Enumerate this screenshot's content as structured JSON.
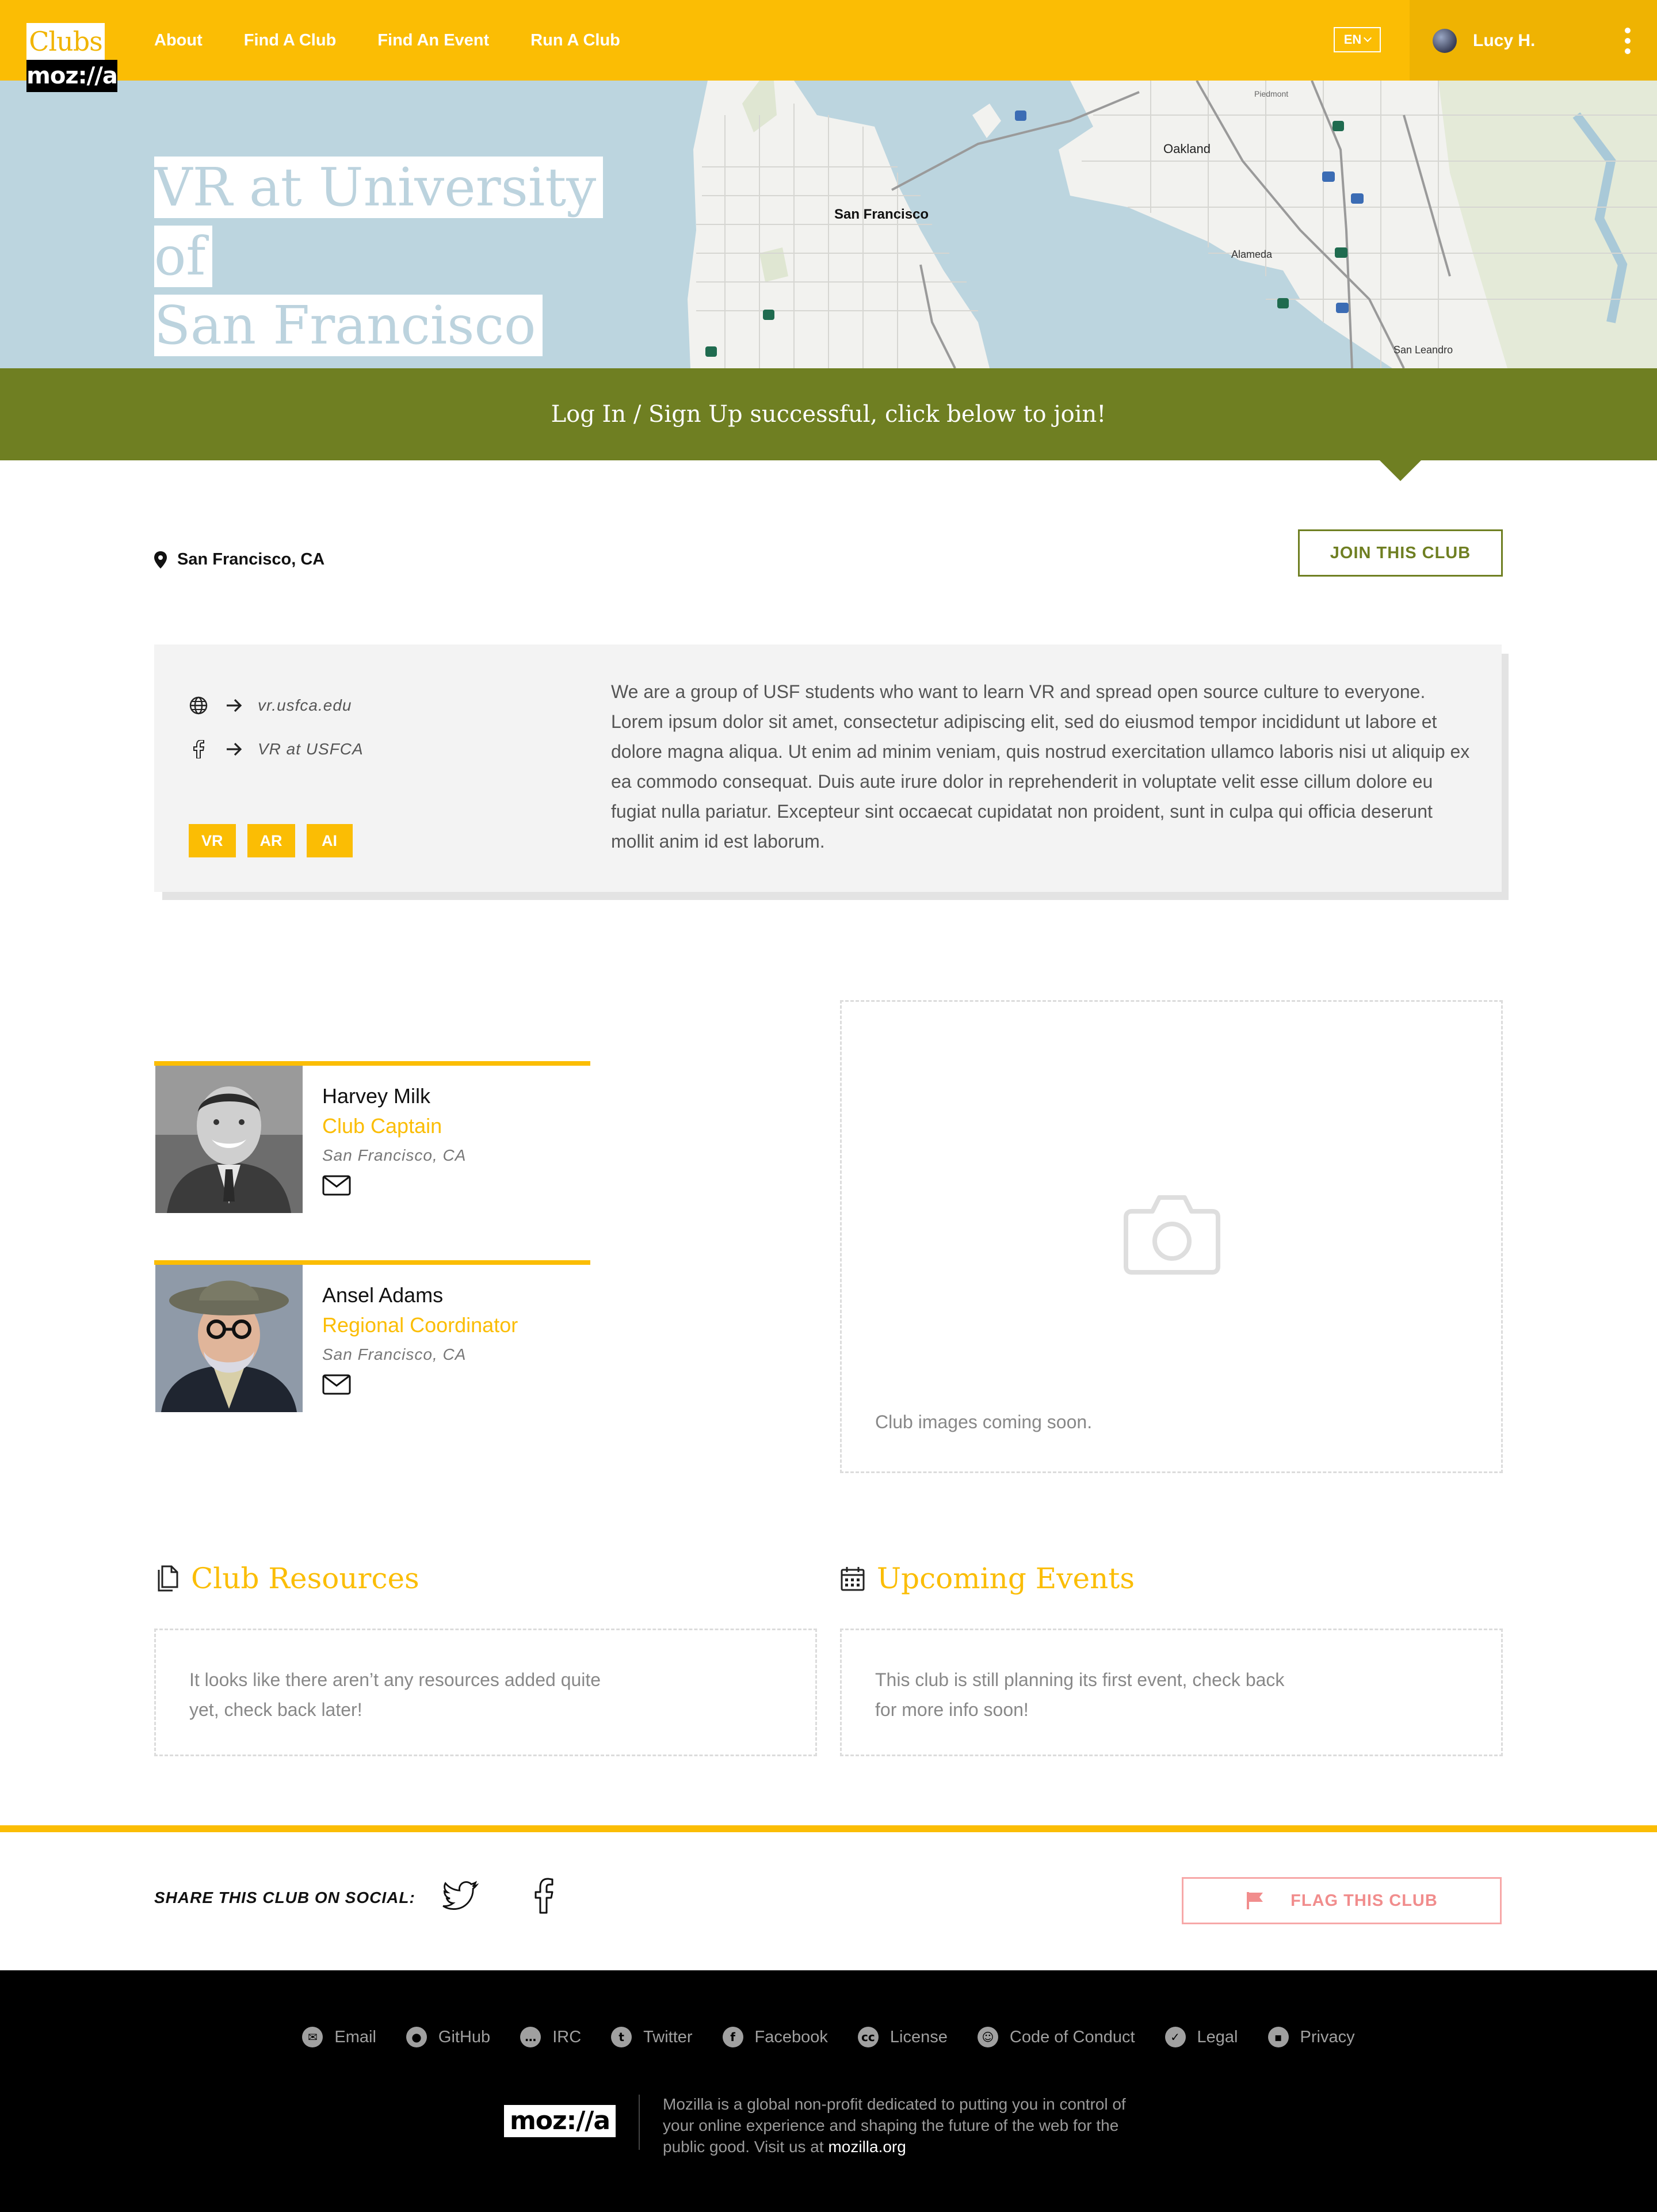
{
  "header": {
    "logo_top": "Clubs",
    "logo_bottom": "moz://a",
    "nav": [
      "About",
      "Find A Club",
      "Find An Event",
      "Run A Club"
    ],
    "lang": "EN",
    "user_name": "Lucy H."
  },
  "hero": {
    "title_line1": "VR at University of",
    "title_line2": "San Francisco",
    "map_labels": {
      "sf": "San Francisco",
      "oakland": "Oakland",
      "alameda": "Alameda",
      "san_leandro": "San Leandro",
      "piedmont": "Piedmont"
    }
  },
  "banner": {
    "message": "Log In / Sign Up successful, click below to join!"
  },
  "club": {
    "location": "San Francisco, CA",
    "join_label": "JOIN THIS CLUB",
    "website": "vr.usfca.edu",
    "facebook": "VR at USFCA",
    "tags": [
      "VR",
      "AR",
      "AI"
    ],
    "description": "We are a group of USF students who want to learn VR and spread open source culture to everyone. Lorem ipsum dolor sit amet, consectetur adipiscing elit, sed do eiusmod tempor incididunt ut labore et dolore magna aliqua. Ut enim ad minim veniam, quis nostrud exercitation ullamco laboris nisi ut aliquip ex ea commodo consequat. Duis aute irure dolor in reprehenderit in voluptate velit esse cillum dolore eu fugiat nulla pariatur. Excepteur sint occaecat cupidatat non proident, sunt in culpa qui officia deserunt mollit anim id est laborum."
  },
  "people": [
    {
      "name": "Harvey Milk",
      "role": "Club Captain",
      "city": "San Francisco, CA"
    },
    {
      "name": "Ansel Adams",
      "role": "Regional Coordinator",
      "city": "San Francisco, CA"
    }
  ],
  "gallery": {
    "message": "Club images coming soon."
  },
  "resources": {
    "title": "Club Resources",
    "empty": "It looks like there aren’t any resources added quite yet, check back later!"
  },
  "events": {
    "title": "Upcoming Events",
    "empty": "This club is still planning its first event, check back for more info soon!"
  },
  "share": {
    "label": "SHARE THIS CLUB ON SOCIAL:",
    "flag_label": "FLAG THIS CLUB"
  },
  "footer": {
    "links": [
      "Email",
      "GitHub",
      "IRC",
      "Twitter",
      "Facebook",
      "License",
      "Code of Conduct",
      "Legal",
      "Privacy"
    ],
    "logo": "moz://a",
    "blurb": "Mozilla is a global non-profit dedicated to putting you in control of your online experience and shaping the future of the web for the public good. Visit us at",
    "site_link": "mozilla.org"
  },
  "colors": {
    "accent": "#fbbd04",
    "olive": "#6f7f22",
    "flag": "#f18d8d",
    "map_water": "#bcd5df"
  }
}
